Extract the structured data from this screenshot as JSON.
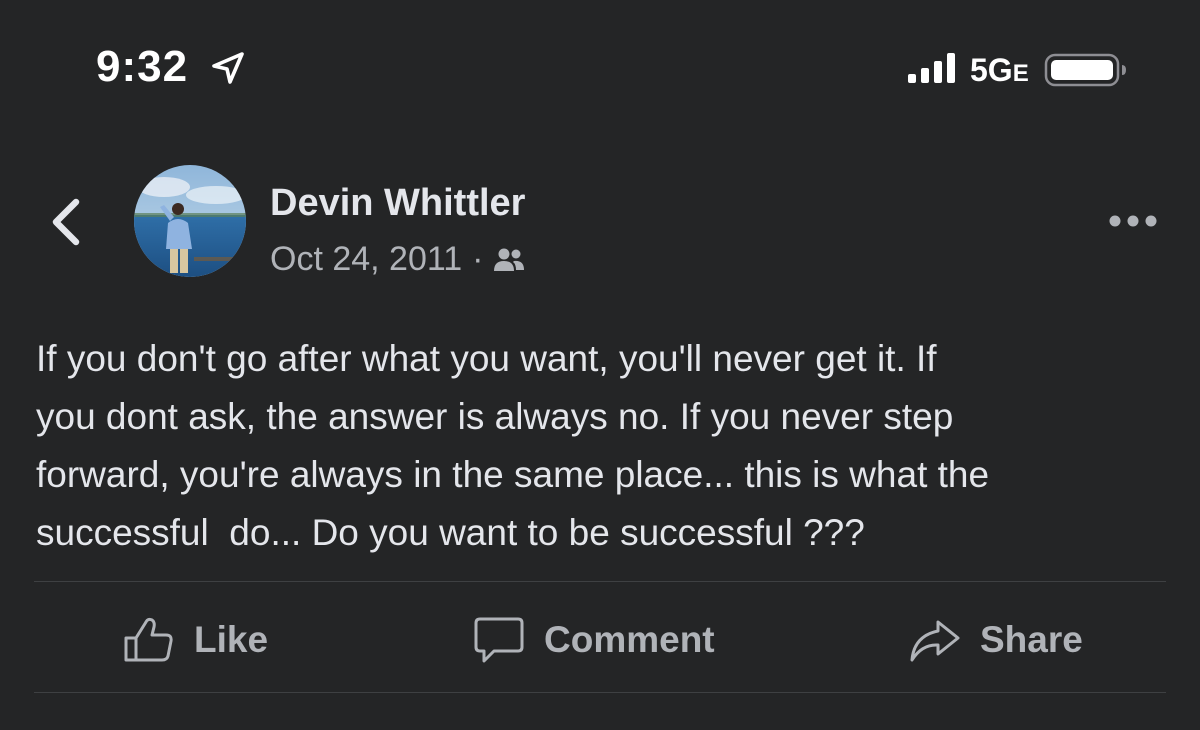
{
  "status_bar": {
    "time": "9:32",
    "network": "5G",
    "network_suffix": "E"
  },
  "post": {
    "author": "Devin Whittler",
    "date": "Oct 24, 2011",
    "separator": "·",
    "audience_icon": "friends-icon",
    "text": "If you don't go after what you want, you'll never get it. If\nyou dont ask, the answer is always no. If you never step\nforward, you're always in the same place... this is what the\nsuccessful  do... Do you want to be successful ???"
  },
  "actions": {
    "like": "Like",
    "comment": "Comment",
    "share": "Share"
  },
  "colors": {
    "background": "#242526",
    "primary_text": "#e4e6eb",
    "secondary_text": "#b0b3b8",
    "divider": "#3e4042"
  }
}
